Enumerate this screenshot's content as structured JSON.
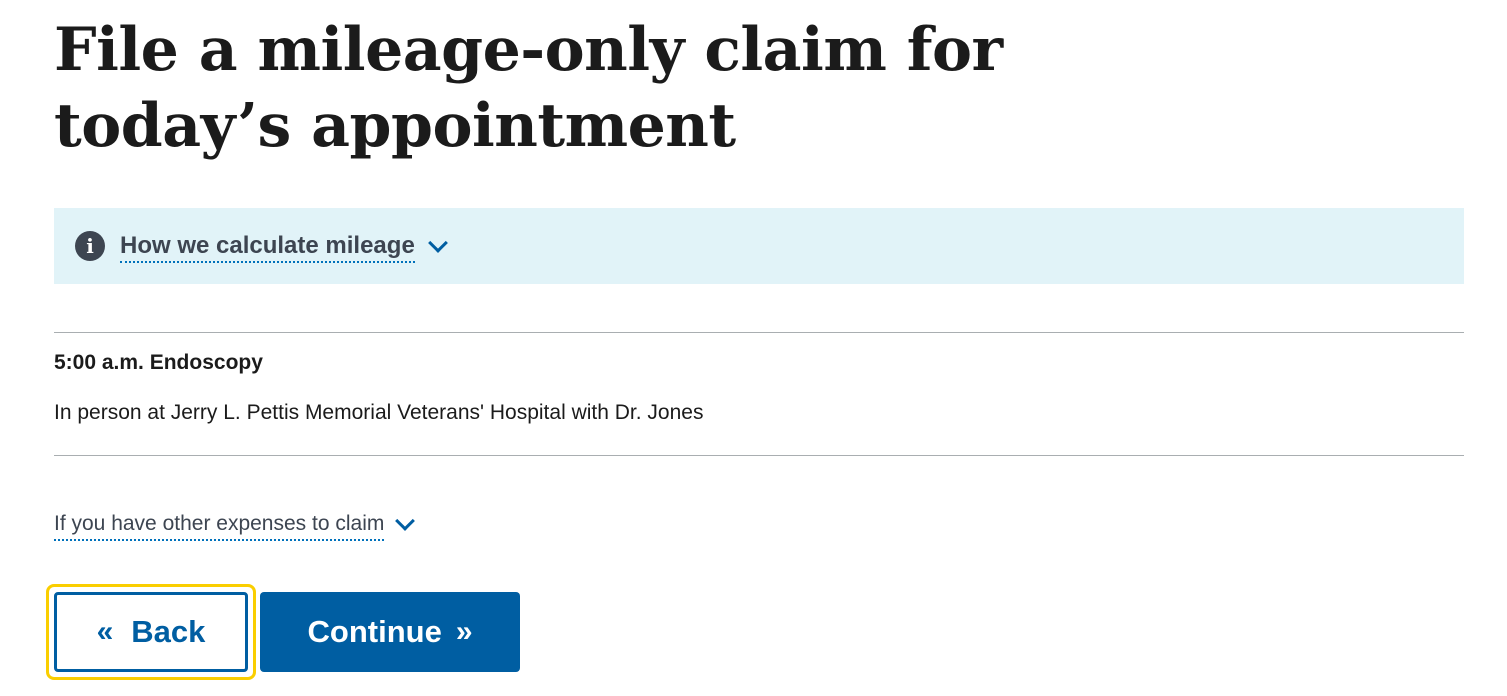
{
  "page": {
    "title": "File a mileage-only claim for today’s appointment"
  },
  "info_alert": {
    "icon": "info-icon",
    "icon_glyph": "i",
    "toggle_label": "How we calculate mileage"
  },
  "appointment": {
    "title": "5:00 a.m. Endoscopy",
    "detail": "In person at Jerry L. Pettis Memorial Veterans' Hospital with Dr. Jones"
  },
  "expenses": {
    "toggle_label": "If you have other expenses to claim"
  },
  "buttons": {
    "back_label": "Back",
    "back_icon_glyph": "«",
    "continue_label": "Continue",
    "continue_icon_glyph": "»"
  },
  "colors": {
    "primary": "#005ea2",
    "alert_background": "#e1f3f8",
    "focus_ring": "#face00",
    "text": "#1b1b1b"
  }
}
